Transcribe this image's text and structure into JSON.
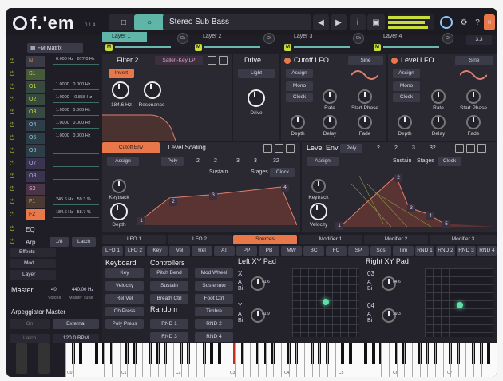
{
  "header": {
    "logo": "f.'em",
    "version": "0.1.4",
    "preset_name": "Stereo Sub Bass",
    "info_icon": "i"
  },
  "layers": [
    {
      "label": "Layer 1",
      "m": "M",
      "badge": "Ch"
    },
    {
      "label": "Layer 2",
      "m": "M",
      "badge": "Ch"
    },
    {
      "label": "Layer 3",
      "m": "M",
      "badge": "Ch"
    },
    {
      "label": "Layer 4",
      "m": "M",
      "badge": "Ch"
    }
  ],
  "layer_value": "3.3",
  "fm_matrix": {
    "title": "FM Matrix",
    "rows": [
      {
        "name": "N",
        "v1": "0.000 Hz",
        "v2": "677.0 Hz"
      },
      {
        "name": "S1",
        "v1": "",
        "v2": ""
      },
      {
        "name": "O1",
        "v1": "1.0000",
        "v2": "0.000 Hz"
      },
      {
        "name": "O2",
        "v1": "1.0000",
        "v2": "-0.858 Hz"
      },
      {
        "name": "O3",
        "v1": "1.0000",
        "v2": "0.000 Hz"
      },
      {
        "name": "O4",
        "v1": "1.0000",
        "v2": "0.000 Hz"
      },
      {
        "name": "O5",
        "v1": "1.0000",
        "v2": "0.000 Hz"
      },
      {
        "name": "O6",
        "v1": "",
        "v2": ""
      },
      {
        "name": "O7",
        "v1": "",
        "v2": ""
      },
      {
        "name": "O8",
        "v1": "",
        "v2": ""
      },
      {
        "name": "S2",
        "v1": "",
        "v2": ""
      },
      {
        "name": "F1",
        "v1": "245.6 Hz",
        "v2": "59.3 %"
      },
      {
        "name": "F2",
        "v1": "184.6 Hz",
        "v2": "58.7 %"
      }
    ]
  },
  "left_lower": {
    "eq": "EQ",
    "arp": "Arp",
    "arp_rate": "1/8",
    "latch": "Latch",
    "effects": "Effects",
    "mod": "Mod",
    "layer": "Layer",
    "master": "Master",
    "voices_val": "40",
    "voices_lbl": "Voices",
    "tune_val": "440.00 Hz",
    "tune_lbl": "Master Tune",
    "arp_master": "Arpeggiator Master",
    "on": "On",
    "external": "External",
    "latch2": "Latch",
    "bpm": "120.0 BPM"
  },
  "filter2": {
    "title": "Filter 2",
    "type": "Sallen-Key LP",
    "invert": "Invert",
    "cutoff": "184.6 Hz",
    "resonance": "Resonance"
  },
  "drive": {
    "title": "Drive",
    "mode": "Light",
    "knob": "Drive"
  },
  "cutoff_lfo": {
    "title": "Cutoff LFO",
    "wave": "Sine",
    "assign": "Assign",
    "mono": "Mono",
    "clock": "Clock",
    "k_rate": "Rate",
    "k_phase": "Start Phase",
    "k_depth": "Depth",
    "k_delay": "Delay",
    "k_fade": "Fade"
  },
  "level_lfo": {
    "title": "Level LFO",
    "wave": "Sine",
    "assign": "Assign",
    "mono": "Mono",
    "clock": "Clock",
    "k_rate": "Rate",
    "k_phase": "Start Phase",
    "k_depth": "Depth",
    "k_delay": "Delay",
    "k_fade": "Fade"
  },
  "cutoff_env": {
    "tab1": "Cutoff Env",
    "tab2": "Level Scaling",
    "assign": "Assign",
    "poly": "Poly",
    "n1": "2",
    "n2": "2",
    "n3": "3",
    "n4": "3",
    "n5": "32",
    "sustain": "Sustain",
    "stages": "Stages",
    "clock": "Clock",
    "keytrack": "Keytrack",
    "depth": "Depth",
    "points": [
      "1",
      "2",
      "3",
      "4"
    ]
  },
  "level_env": {
    "title": "Level Env",
    "assign": "Assign",
    "poly": "Poly",
    "n1": "2",
    "n2": "2",
    "n3": "3",
    "n4": "32",
    "sustain": "Sustain",
    "stages": "Stages",
    "clock": "Clock",
    "keytrack": "Keytrack",
    "velocity": "Velocity",
    "points": [
      "1",
      "2",
      "3",
      "4",
      "5"
    ]
  },
  "mod_tabs": {
    "top": [
      "LFO 1",
      "LFO 2",
      "Sources",
      "Modifier 1",
      "Modifier 2",
      "Modifier 3"
    ],
    "sub": [
      "LFO 1",
      "LFO 2",
      "Key",
      "Vel",
      "Rel",
      "AT",
      "PP",
      "PB",
      "MW",
      "BC",
      "FC",
      "SP",
      "Sos",
      "Tim",
      "RND 1",
      "RND 2",
      "RND 3",
      "RND 4"
    ]
  },
  "keyboard": {
    "title": "Keyboard",
    "items": [
      "Key",
      "Velocity",
      "Rel Vel",
      "Ch Press",
      "Poly Press"
    ]
  },
  "controllers": {
    "title": "Controllers",
    "col1": [
      "Pitch Bend",
      "Sustain",
      "Breath Ctrl"
    ],
    "col2": [
      "Mod Wheel",
      "Sostenuto",
      "Foot Ctrl"
    ],
    "random_title": "Random",
    "rand1": [
      "RND 1",
      "RND 3"
    ],
    "rand2": [
      "Timbre",
      "RND 2",
      "RND 4"
    ]
  },
  "left_xy": {
    "title": "Left XY Pad",
    "x": "X",
    "y": "Y",
    "xv": "61.6",
    "yv": "61.9",
    "a": "A",
    "b": "B",
    "bi": "Bi"
  },
  "right_xy": {
    "title": "Right XY Pad",
    "c3": "03",
    "c4": "04",
    "v3": "64.6",
    "v4": "59.3",
    "a": "A",
    "b": "B",
    "bi": "Bi"
  },
  "piano": {
    "labels": [
      "C0",
      "C1",
      "C2",
      "C3",
      "C4",
      "C5",
      "C6",
      "C7"
    ]
  },
  "colors": {
    "accent_teal": "#5fb5a8",
    "accent_yellow": "#c8dc3c",
    "accent_orange": "#e8784a",
    "panel": "#2a2830"
  }
}
